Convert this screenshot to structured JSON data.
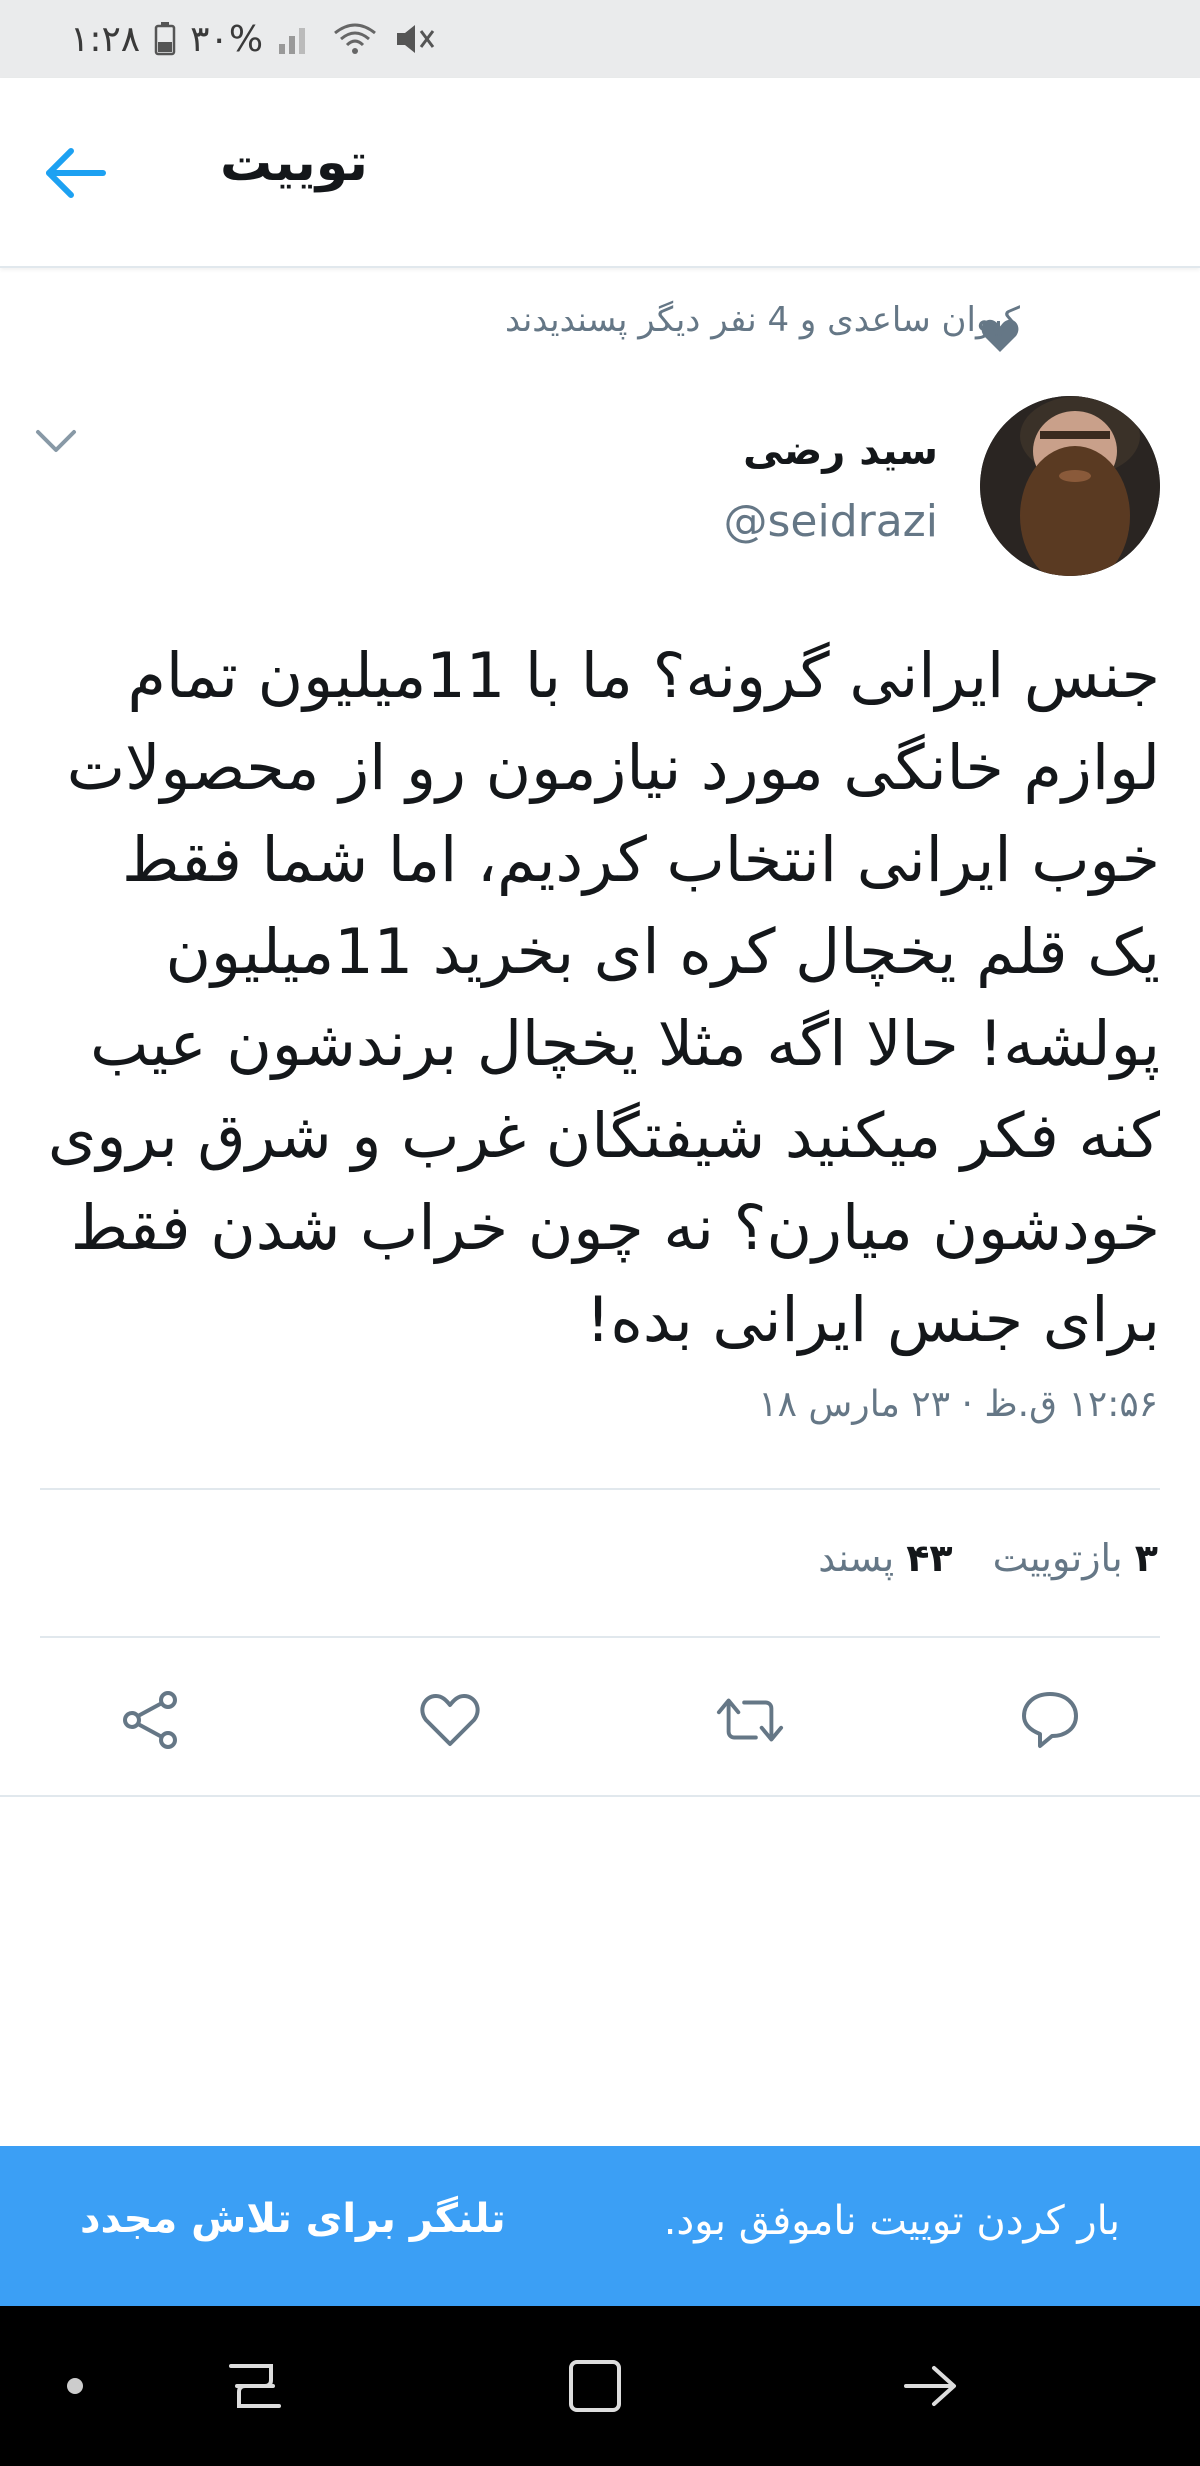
{
  "status_bar": {
    "time": "۱:۲۸",
    "battery": "۳۰%"
  },
  "header": {
    "title": "توییت",
    "back_icon": "arrow-left-icon"
  },
  "liked_by": {
    "text": "کیوان ساعدی و 4 نفر دیگر پسندیدند"
  },
  "tweet": {
    "author_name": "سید رضی",
    "author_handle": "@seidrazi",
    "lines": [
      "جنس ایرانی گرونه؟ ما با 11میلیون تمام",
      "لوازم خانگی مورد نیازمون رو از محصولات",
      "خوب ایرانی انتخاب کردیم، اما شما فقط",
      "یک قلم یخچال کره ای بخرید 11میلیون",
      "پولشه! حالا اگه مثلا یخچال برندشون عیب",
      "کنه فکر میکنید شیفتگان غرب و شرق بروی",
      "خودشون میارن؟ نه چون خراب شدن فقط",
      "برای جنس ایرانی بده!"
    ],
    "timestamp": "۱۲:۵۶ ق.ظ · ۲۳ مارس ۱۸"
  },
  "stats": {
    "retweets_count": "۳",
    "retweets_label": "بازتوییت",
    "likes_count": "۴۳",
    "likes_label": "پسند"
  },
  "snackbar": {
    "message": "بار کردن توییت ناموفق بود.",
    "action": "تلنگر برای تلاش مجدد"
  },
  "colors": {
    "accent": "#1da1f2",
    "snackbar_bg": "#3b9ff5",
    "muted": "#657786"
  }
}
